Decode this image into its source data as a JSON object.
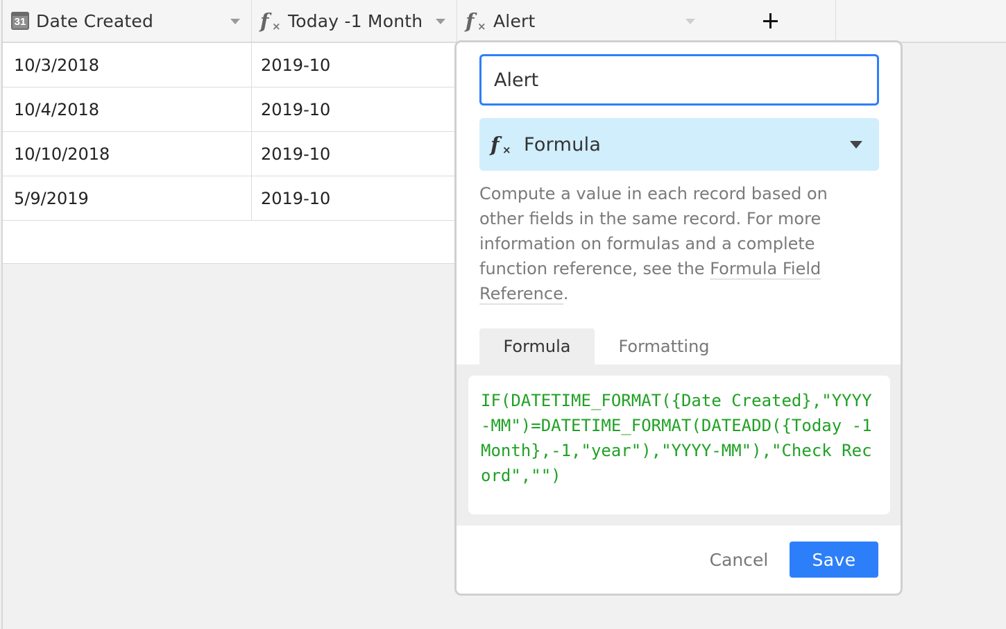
{
  "columns": [
    {
      "label": "Date Created",
      "icon": "calendar-icon",
      "icon_text": "31"
    },
    {
      "label": "Today -1 Month",
      "icon": "formula-icon"
    },
    {
      "label": "Alert",
      "icon": "formula-icon"
    }
  ],
  "add_column_symbol": "+",
  "rows": [
    {
      "date_created": "10/3/2018",
      "today_minus_month": "2019-10"
    },
    {
      "date_created": "10/4/2018",
      "today_minus_month": "2019-10"
    },
    {
      "date_created": "10/10/2018",
      "today_minus_month": "2019-10"
    },
    {
      "date_created": "5/9/2019",
      "today_minus_month": "2019-10"
    }
  ],
  "field_editor": {
    "name_value": "Alert",
    "field_type": "Formula",
    "description_before_link": "Compute a value in each record based on other fields in the same record. For more information on formulas and a complete function reference, see the ",
    "description_link": "Formula Field Reference",
    "description_after_link": ".",
    "tabs": [
      {
        "label": "Formula",
        "active": true
      },
      {
        "label": "Formatting",
        "active": false
      }
    ],
    "formula": "IF(DATETIME_FORMAT({Date Created},\"YYYY-MM\")=DATETIME_FORMAT(DATEADD({Today -1 Month},-1,\"year\"),\"YYYY-MM\"),\"Check Record\",\"\")",
    "cancel_label": "Cancel",
    "save_label": "Save"
  },
  "colors": {
    "accent": "#2d7ff9",
    "type_select_bg": "#d1eefc",
    "formula_text": "#20a125"
  }
}
